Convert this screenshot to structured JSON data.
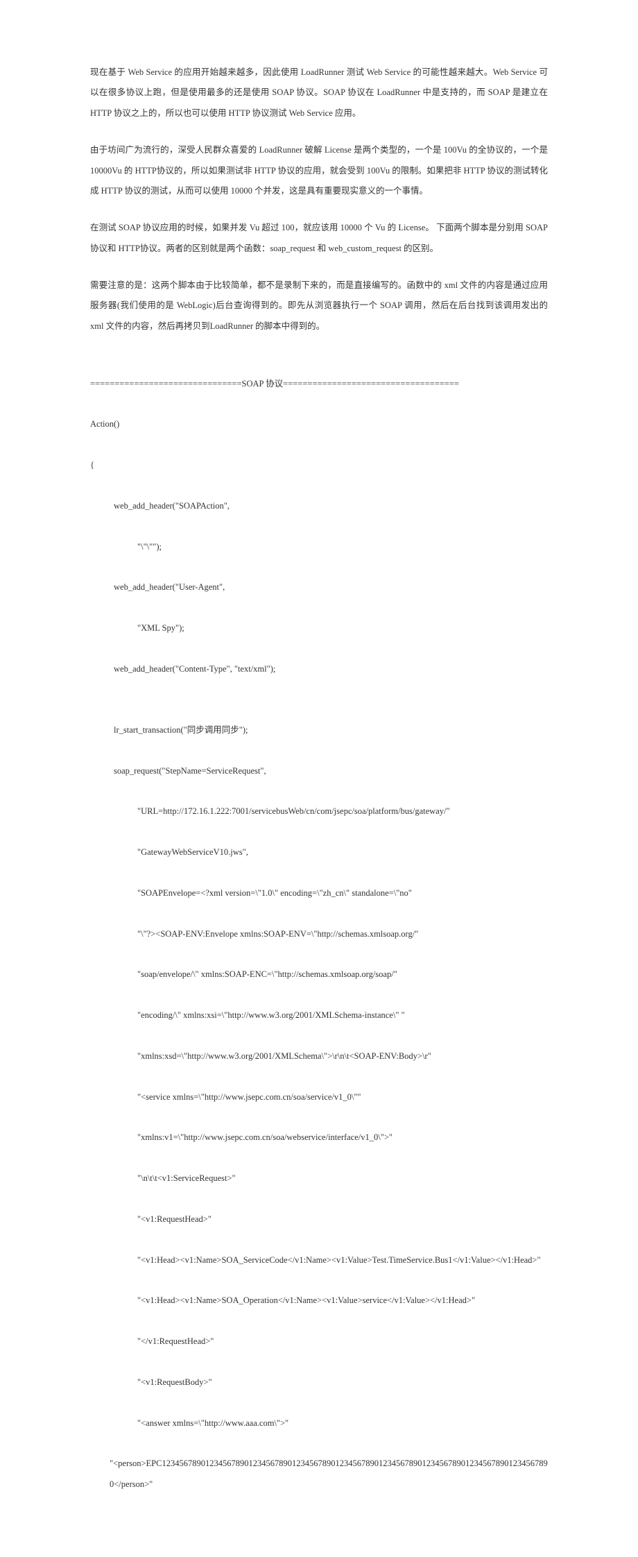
{
  "paragraphs": {
    "p1": "现在基于 Web Service 的应用开始越来越多，因此使用 LoadRunner 测试 Web Service 的可能性越来越大。Web Service 可以在很多协议上跑，但是使用最多的还是使用 SOAP 协议。SOAP 协议在 LoadRunner 中是支持的，而 SOAP 是建立在 HTTP 协议之上的，所以也可以使用 HTTP 协议测试 Web Service 应用。",
    "p2": "由于坊间广为流行的，深受人民群众喜爱的 LoadRunner 破解 License 是两个类型的，一个是 100Vu 的全协议的，一个是 10000Vu 的 HTTP协议的，所以如果测试非 HTTP 协议的应用，就会受到 100Vu 的限制。如果把非 HTTP 协议的测试转化成 HTTP 协议的测试，从而可以使用 10000 个并发，这是具有重要现实意义的一个事情。",
    "p3": "在测试 SOAP 协议应用的时候，如果并发 Vu 超过 100，就应该用 10000 个 Vu 的 License。 下面两个脚本是分别用 SOAP 协议和 HTTP协议。两者的区别就是两个函数：soap_request 和 web_custom_request 的区别。",
    "p4": "需要注意的是：这两个脚本由于比较简单，都不是录制下来的，而是直接编写的。函数中的 xml 文件的内容是通过应用服务器(我们使用的是 WebLogic)后台查询得到的。即先从浏览器执行一个 SOAP 调用，然后在后台找到该调用发出的 xml 文件的内容，然后再拷贝到LoadRunner 的脚本中得到的。"
  },
  "code": {
    "l0": "===============================SOAP 协议====================================",
    "l1": "Action()",
    "l2": "{",
    "l3": "web_add_header(\"SOAPAction\",",
    "l4": "\"\\\"\\\"\");",
    "l5": "web_add_header(\"User-Agent\",",
    "l6": "\"XML Spy\");",
    "l7": "web_add_header(\"Content-Type\", \"text/xml\");",
    "gap": "",
    "l8": "lr_start_transaction(\"同步调用同步\");",
    "l9": "soap_request(\"StepName=ServiceRequest\",",
    "l10": "\"URL=http://172.16.1.222:7001/servicebusWeb/cn/com/jsepc/soa/platform/bus/gateway/\"",
    "l11": "\"GatewayWebServiceV10.jws\",",
    "l12": "\"SOAPEnvelope=<?xml version=\\\"1.0\\\" encoding=\\\"zh_cn\\\" standalone=\\\"no\"",
    "l13": "\"\\\"?><SOAP-ENV:Envelope xmlns:SOAP-ENV=\\\"http://schemas.xmlsoap.org/\"",
    "l14": "\"soap/envelope/\\\" xmlns:SOAP-ENC=\\\"http://schemas.xmlsoap.org/soap/\"",
    "l15": "\"encoding/\\\" xmlns:xsi=\\\"http://www.w3.org/2001/XMLSchema-instance\\\" \"",
    "l16": "\"xmlns:xsd=\\\"http://www.w3.org/2001/XMLSchema\\\">\\r\\n\\t<SOAP-ENV:Body>\\r\"",
    "l17": "\"<service xmlns=\\\"http://www.jsepc.com.cn/soa/service/v1_0\\\"\"",
    "l18": "\"xmlns:v1=\\\"http://www.jsepc.com.cn/soa/webservice/interface/v1_0\\\">\"",
    "l19": "\"\\n\\t\\t<v1:ServiceRequest>\"",
    "l20": "\"<v1:RequestHead>\"",
    "l21": "\"<v1:Head><v1:Name>SOA_ServiceCode</v1:Name><v1:Value>Test.TimeService.Bus1</v1:Value></v1:Head>\"",
    "l22": "\"<v1:Head><v1:Name>SOA_Operation</v1:Name><v1:Value>service</v1:Value></v1:Head>\"",
    "l23": "\"</v1:RequestHead>\"",
    "l24": "\"<v1:RequestBody>\"",
    "l25": "\"<answer xmlns=\\\"http://www.aaa.com\\\">\"",
    "l26": "\"<person>EPC123456789012345678901234567890123456789012345678901234567890123456789012345678901234567890</person>\""
  }
}
